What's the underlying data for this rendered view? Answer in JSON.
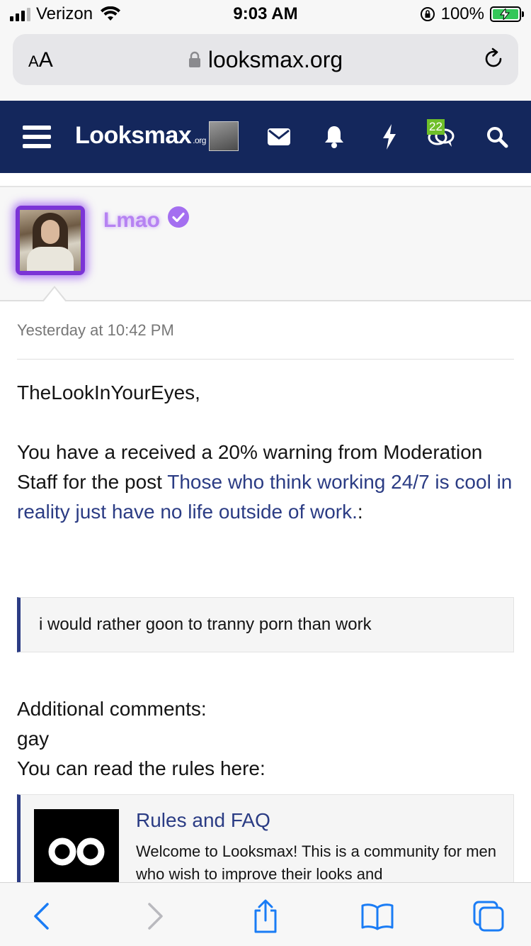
{
  "status_bar": {
    "carrier": "Verizon",
    "time": "9:03 AM",
    "battery": "100%"
  },
  "browser": {
    "text_size_label_small": "A",
    "text_size_label_large": "A",
    "url": "looksmax.org"
  },
  "site_header": {
    "logo_text": "Looksmax",
    "logo_suffix": ".org",
    "conversations_count": "22"
  },
  "profile": {
    "username": "Lmao",
    "verified": true
  },
  "message": {
    "timestamp": "Yesterday at 10:42 PM",
    "greeting": "TheLookInYourEyes,",
    "warning_text": "You have a received a 20% warning from Moderation Staff for the post ",
    "post_link": "Those who think working 24/7 is cool in reality just have no life outside of work.",
    "post_link_suffix": ":",
    "quote": "i would rather goon to tranny porn than work",
    "additional_label": "Additional comments:",
    "additional_value": "gay",
    "rules_text": "You can read the rules here:",
    "embed_title": "Rules and FAQ",
    "embed_desc": "Welcome to Looksmax! This is a community for men who wish to improve their looks and"
  },
  "colors": {
    "header_bg": "#14275c",
    "link": "#2b3c84",
    "username": "#b682f2",
    "badge": "#6fbf2a",
    "ios_blue": "#1a7cf5"
  }
}
